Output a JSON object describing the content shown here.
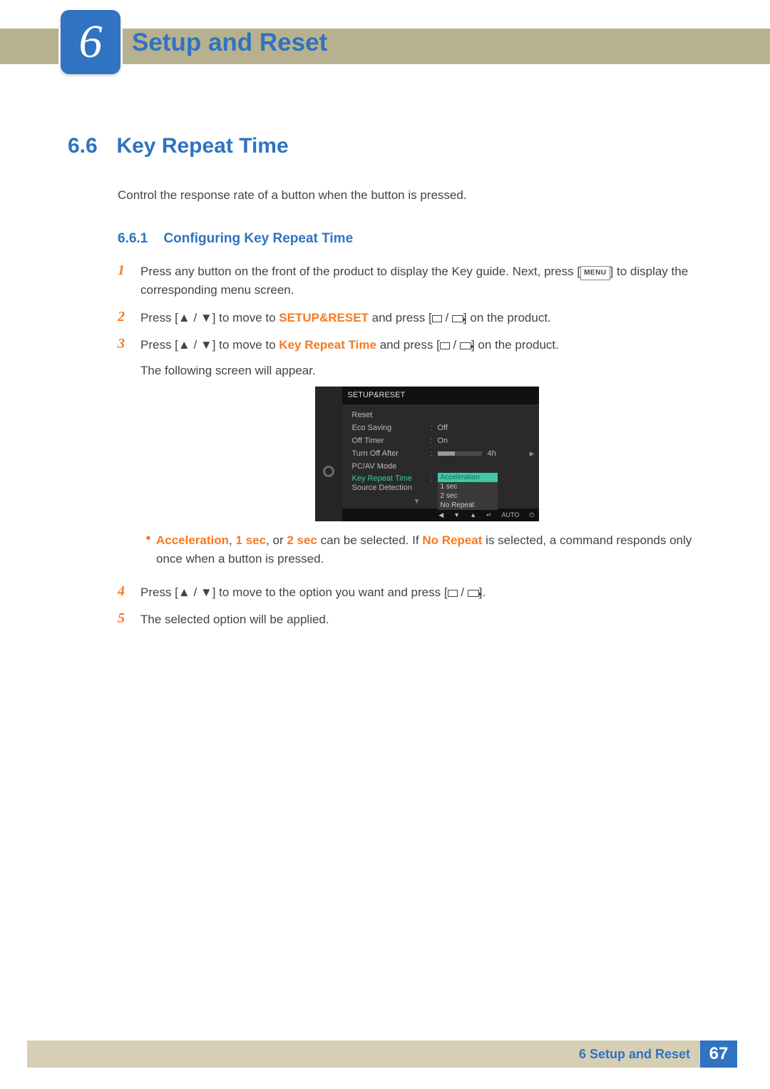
{
  "chapter": {
    "number": "6",
    "title": "Setup and Reset"
  },
  "section": {
    "number": "6.6",
    "title": "Key Repeat Time",
    "intro": "Control the response rate of a button when the button is pressed."
  },
  "subsection": {
    "number": "6.6.1",
    "title": "Configuring Key Repeat Time"
  },
  "steps": {
    "s1_a": "Press any button on the front of the product to display the Key guide. Next, press [",
    "s1_menu": "MENU",
    "s1_b": "] to display the corresponding menu screen.",
    "s2_a": "Press [",
    "s2_b": "] to move to ",
    "s2_setup": "SETUP&RESET",
    "s2_c": " and press [",
    "s2_d": "] on the product.",
    "s3_a": "Press [",
    "s3_b": "] to move to ",
    "s3_krt": "Key Repeat Time",
    "s3_c": " and press [",
    "s3_d": "] on the product.",
    "s3_follow": "The following screen will appear.",
    "bullet_a": "Acceleration",
    "bullet_sep1": ", ",
    "bullet_b": "1 sec",
    "bullet_sep2": ", or ",
    "bullet_c": "2 sec",
    "bullet_mid": " can be selected. If ",
    "bullet_d": "No Repeat",
    "bullet_end": " is selected, a command responds only once when a button is pressed.",
    "s4_a": "Press [",
    "s4_b": "] to move to the option you want and press [",
    "s4_c": "].",
    "s5": "The selected option will be applied."
  },
  "step_numbers": {
    "n1": "1",
    "n2": "2",
    "n3": "3",
    "n4": "4",
    "n5": "5"
  },
  "osd": {
    "title": "SETUP&RESET",
    "rows": {
      "reset": "Reset",
      "eco": "Eco Saving",
      "eco_val": "Off",
      "offtimer": "Off Timer",
      "offtimer_val": "On",
      "turnoff": "Turn Off After",
      "turnoff_val": "4h",
      "pcav": "PC/AV Mode",
      "krt": "Key Repeat Time",
      "source": "Source Detection"
    },
    "dropdown": {
      "o1": "Acceleration",
      "o2": "1 sec",
      "o3": "2 sec",
      "o4": "No Repeat"
    },
    "bottom_auto": "AUTO"
  },
  "footer": {
    "chapter_label": "6 Setup and Reset",
    "page": "67"
  }
}
